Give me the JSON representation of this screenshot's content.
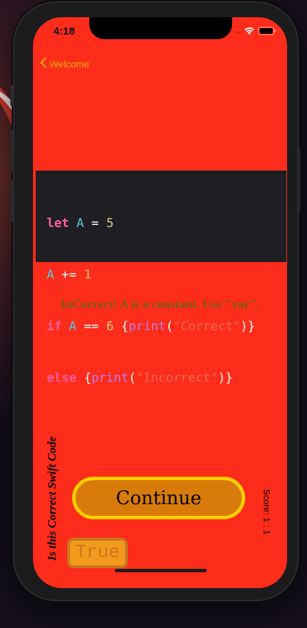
{
  "status_bar": {
    "time": "4:18",
    "signal": "....."
  },
  "nav": {
    "back_label": "Welcome"
  },
  "code": {
    "lines": [
      [
        {
          "t": "let",
          "c": "kw"
        },
        {
          "t": " ",
          "c": "plain"
        },
        {
          "t": "A",
          "c": "id"
        },
        {
          "t": " = ",
          "c": "plain"
        },
        {
          "t": "5",
          "c": "num"
        }
      ],
      [
        {
          "t": "A",
          "c": "id"
        },
        {
          "t": " += ",
          "c": "plain"
        },
        {
          "t": "1",
          "c": "num"
        }
      ],
      [
        {
          "t": "if",
          "c": "kw"
        },
        {
          "t": " ",
          "c": "plain"
        },
        {
          "t": "A",
          "c": "id"
        },
        {
          "t": " == ",
          "c": "plain"
        },
        {
          "t": "6",
          "c": "num"
        },
        {
          "t": " {",
          "c": "plain"
        },
        {
          "t": "print",
          "c": "fn"
        },
        {
          "t": "(",
          "c": "plain"
        },
        {
          "t": "\"Correct\"",
          "c": "str"
        },
        {
          "t": ")}",
          "c": "plain"
        }
      ],
      [
        {
          "t": "else",
          "c": "kw"
        },
        {
          "t": " {",
          "c": "plain"
        },
        {
          "t": "print",
          "c": "fn"
        },
        {
          "t": "(",
          "c": "plain"
        },
        {
          "t": "\"Incorrect\"",
          "c": "str"
        },
        {
          "t": ")}",
          "c": "plain"
        }
      ]
    ]
  },
  "result_text": "InCorrect! A is a constant. Use \"var\".",
  "vertical_title": "Is this Correct Swift Code",
  "continue_label": "Continue",
  "score_text": "Score: 1 : 1",
  "answer_button_label": "True",
  "colors": {
    "screen_background": "#fe2c1a",
    "accent_yellow": "#ffd000",
    "continue_fill": "#d97b0a",
    "back_link": "#f5b200"
  }
}
